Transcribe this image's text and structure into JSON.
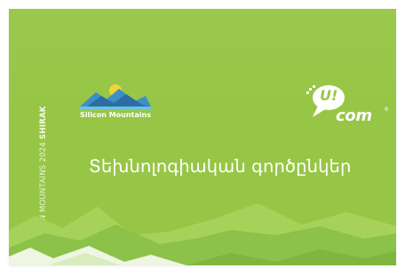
{
  "vertical_label": {
    "main": "SILICON MOUNTAINS 2024 ",
    "bold": "SHIRAK"
  },
  "silicon_logo": {
    "name": "Silicon Mountains"
  },
  "ucom_logo": {
    "brand": "com",
    "mark": "U!",
    "registered": "®"
  },
  "headline": "Տեխնոլոգիական գործընկեր",
  "colors": {
    "background": "#97c646",
    "white": "#ffffff",
    "mountain_blue": "#4aa8d8",
    "sun": "#f3d23a"
  }
}
